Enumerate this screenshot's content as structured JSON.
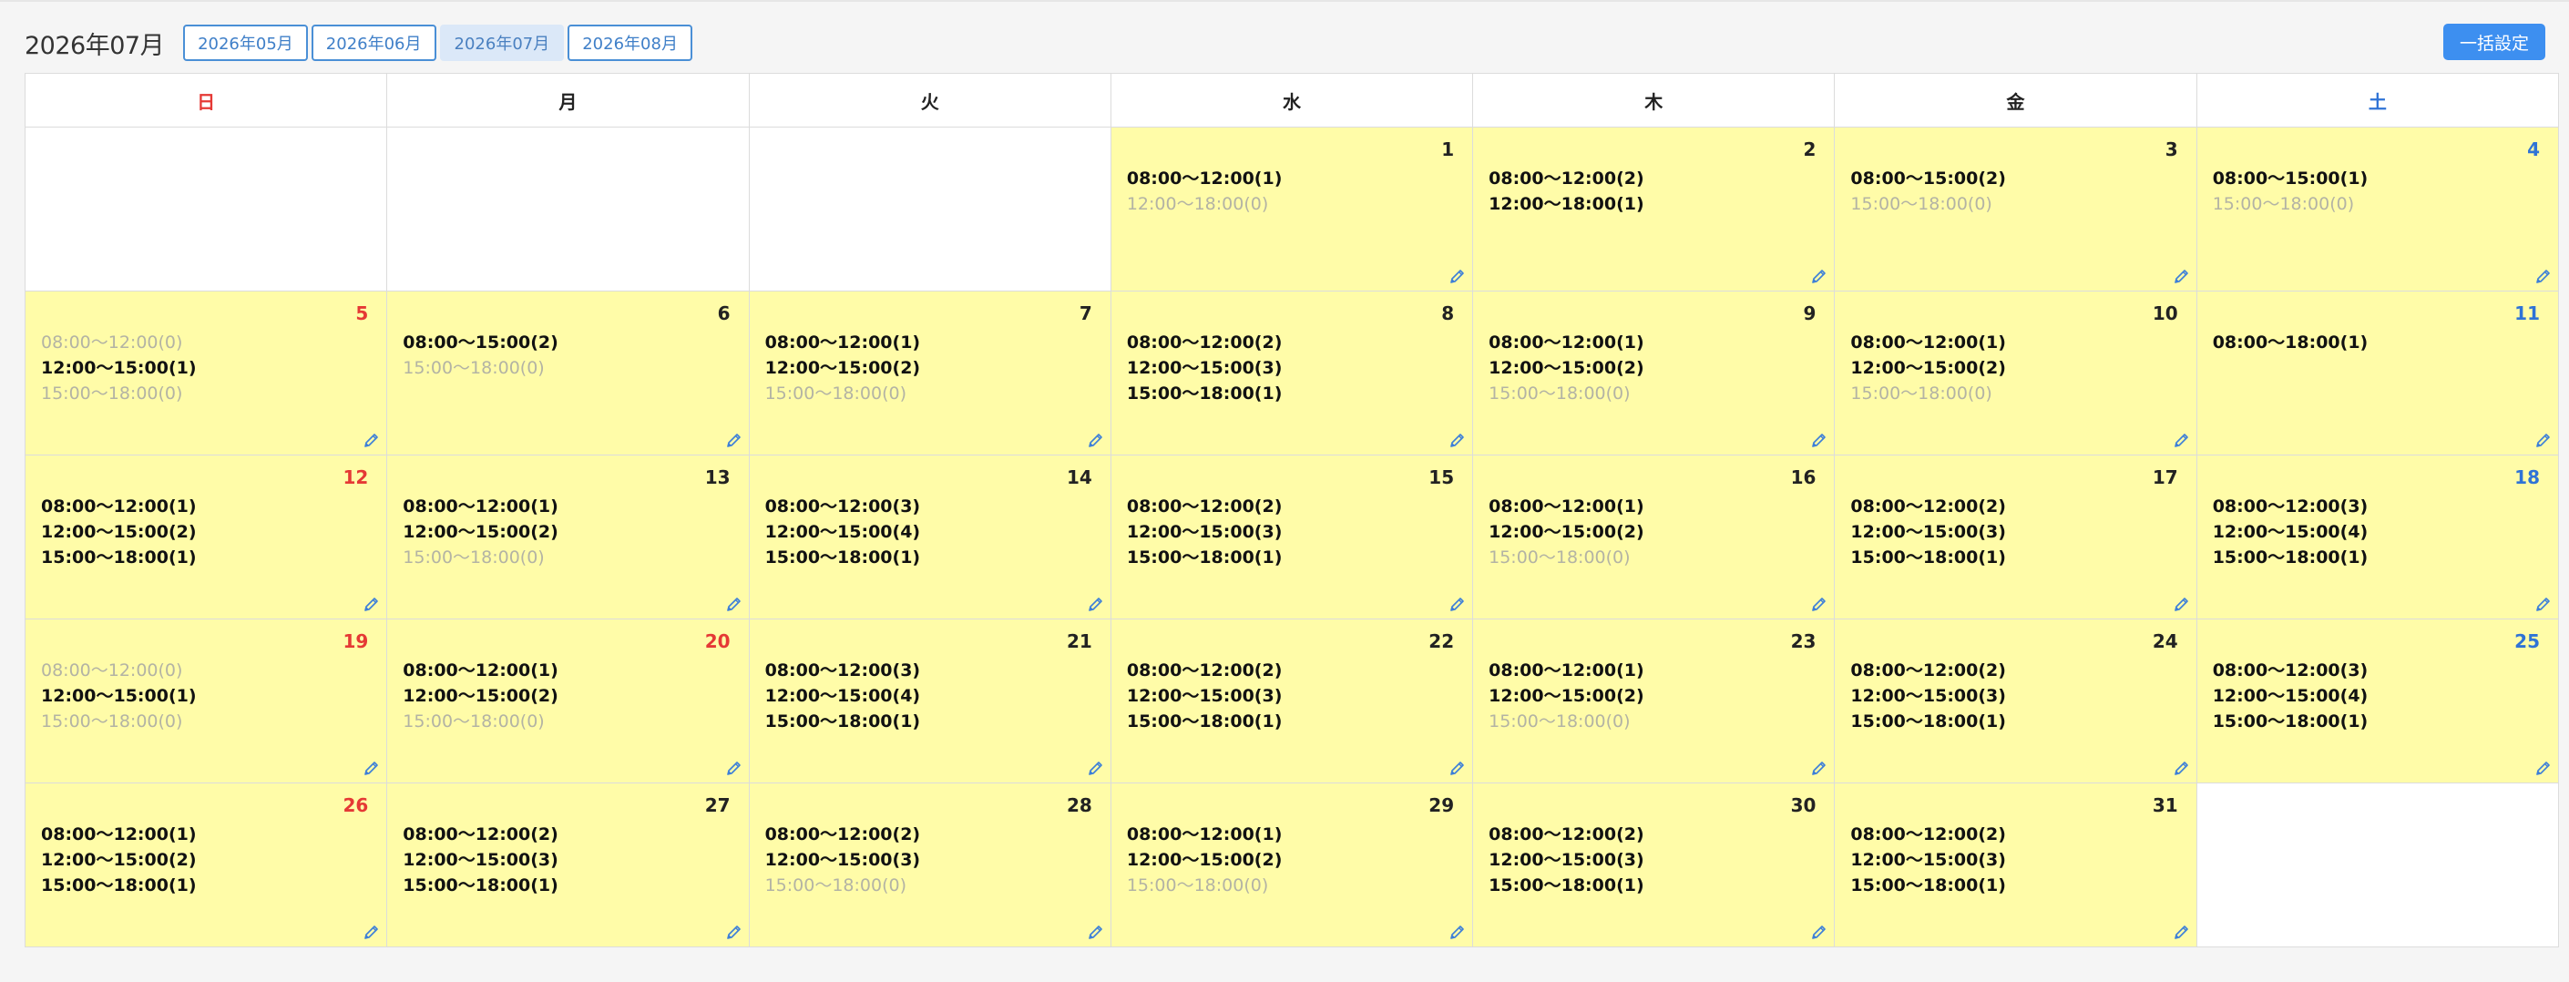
{
  "header": {
    "title": "2026年07月",
    "months": [
      {
        "label": "2026年05月",
        "active": false
      },
      {
        "label": "2026年06月",
        "active": false
      },
      {
        "label": "2026年07月",
        "active": true
      },
      {
        "label": "2026年08月",
        "active": false
      }
    ],
    "bulk_label": "一括設定"
  },
  "weekdays": [
    "日",
    "月",
    "火",
    "水",
    "木",
    "金",
    "土"
  ],
  "colors": {
    "sunday": "#e53935",
    "saturday": "#2f73d6",
    "cell_fill": "#fffca8",
    "accent": "#3d8ff0"
  },
  "weeks": [
    [
      null,
      null,
      null,
      {
        "day": "1",
        "slots": [
          {
            "text": "08:00〜12:00(1)",
            "zero": false
          },
          {
            "text": "12:00〜18:00(0)",
            "zero": true
          }
        ]
      },
      {
        "day": "2",
        "slots": [
          {
            "text": "08:00〜12:00(2)",
            "zero": false
          },
          {
            "text": "12:00〜18:00(1)",
            "zero": false
          }
        ]
      },
      {
        "day": "3",
        "slots": [
          {
            "text": "08:00〜15:00(2)",
            "zero": false
          },
          {
            "text": "15:00〜18:00(0)",
            "zero": true
          }
        ]
      },
      {
        "day": "4",
        "slots": [
          {
            "text": "08:00〜15:00(1)",
            "zero": false
          },
          {
            "text": "15:00〜18:00(0)",
            "zero": true
          }
        ]
      }
    ],
    [
      {
        "day": "5",
        "slots": [
          {
            "text": "08:00〜12:00(0)",
            "zero": true
          },
          {
            "text": "12:00〜15:00(1)",
            "zero": false
          },
          {
            "text": "15:00〜18:00(0)",
            "zero": true
          }
        ]
      },
      {
        "day": "6",
        "slots": [
          {
            "text": "08:00〜15:00(2)",
            "zero": false
          },
          {
            "text": "15:00〜18:00(0)",
            "zero": true
          }
        ]
      },
      {
        "day": "7",
        "slots": [
          {
            "text": "08:00〜12:00(1)",
            "zero": false
          },
          {
            "text": "12:00〜15:00(2)",
            "zero": false
          },
          {
            "text": "15:00〜18:00(0)",
            "zero": true
          }
        ]
      },
      {
        "day": "8",
        "slots": [
          {
            "text": "08:00〜12:00(2)",
            "zero": false
          },
          {
            "text": "12:00〜15:00(3)",
            "zero": false
          },
          {
            "text": "15:00〜18:00(1)",
            "zero": false
          }
        ]
      },
      {
        "day": "9",
        "slots": [
          {
            "text": "08:00〜12:00(1)",
            "zero": false
          },
          {
            "text": "12:00〜15:00(2)",
            "zero": false
          },
          {
            "text": "15:00〜18:00(0)",
            "zero": true
          }
        ]
      },
      {
        "day": "10",
        "slots": [
          {
            "text": "08:00〜12:00(1)",
            "zero": false
          },
          {
            "text": "12:00〜15:00(2)",
            "zero": false
          },
          {
            "text": "15:00〜18:00(0)",
            "zero": true
          }
        ]
      },
      {
        "day": "11",
        "slots": [
          {
            "text": "08:00〜18:00(1)",
            "zero": false
          }
        ]
      }
    ],
    [
      {
        "day": "12",
        "slots": [
          {
            "text": "08:00〜12:00(1)",
            "zero": false
          },
          {
            "text": "12:00〜15:00(2)",
            "zero": false
          },
          {
            "text": "15:00〜18:00(1)",
            "zero": false
          }
        ]
      },
      {
        "day": "13",
        "slots": [
          {
            "text": "08:00〜12:00(1)",
            "zero": false
          },
          {
            "text": "12:00〜15:00(2)",
            "zero": false
          },
          {
            "text": "15:00〜18:00(0)",
            "zero": true
          }
        ]
      },
      {
        "day": "14",
        "slots": [
          {
            "text": "08:00〜12:00(3)",
            "zero": false
          },
          {
            "text": "12:00〜15:00(4)",
            "zero": false
          },
          {
            "text": "15:00〜18:00(1)",
            "zero": false
          }
        ]
      },
      {
        "day": "15",
        "slots": [
          {
            "text": "08:00〜12:00(2)",
            "zero": false
          },
          {
            "text": "12:00〜15:00(3)",
            "zero": false
          },
          {
            "text": "15:00〜18:00(1)",
            "zero": false
          }
        ]
      },
      {
        "day": "16",
        "slots": [
          {
            "text": "08:00〜12:00(1)",
            "zero": false
          },
          {
            "text": "12:00〜15:00(2)",
            "zero": false
          },
          {
            "text": "15:00〜18:00(0)",
            "zero": true
          }
        ]
      },
      {
        "day": "17",
        "slots": [
          {
            "text": "08:00〜12:00(2)",
            "zero": false
          },
          {
            "text": "12:00〜15:00(3)",
            "zero": false
          },
          {
            "text": "15:00〜18:00(1)",
            "zero": false
          }
        ]
      },
      {
        "day": "18",
        "slots": [
          {
            "text": "08:00〜12:00(3)",
            "zero": false
          },
          {
            "text": "12:00〜15:00(4)",
            "zero": false
          },
          {
            "text": "15:00〜18:00(1)",
            "zero": false
          }
        ]
      }
    ],
    [
      {
        "day": "19",
        "slots": [
          {
            "text": "08:00〜12:00(0)",
            "zero": true
          },
          {
            "text": "12:00〜15:00(1)",
            "zero": false
          },
          {
            "text": "15:00〜18:00(0)",
            "zero": true
          }
        ]
      },
      {
        "day": "20",
        "holiday": true,
        "slots": [
          {
            "text": "08:00〜12:00(1)",
            "zero": false
          },
          {
            "text": "12:00〜15:00(2)",
            "zero": false
          },
          {
            "text": "15:00〜18:00(0)",
            "zero": true
          }
        ]
      },
      {
        "day": "21",
        "slots": [
          {
            "text": "08:00〜12:00(3)",
            "zero": false
          },
          {
            "text": "12:00〜15:00(4)",
            "zero": false
          },
          {
            "text": "15:00〜18:00(1)",
            "zero": false
          }
        ]
      },
      {
        "day": "22",
        "slots": [
          {
            "text": "08:00〜12:00(2)",
            "zero": false
          },
          {
            "text": "12:00〜15:00(3)",
            "zero": false
          },
          {
            "text": "15:00〜18:00(1)",
            "zero": false
          }
        ]
      },
      {
        "day": "23",
        "slots": [
          {
            "text": "08:00〜12:00(1)",
            "zero": false
          },
          {
            "text": "12:00〜15:00(2)",
            "zero": false
          },
          {
            "text": "15:00〜18:00(0)",
            "zero": true
          }
        ]
      },
      {
        "day": "24",
        "slots": [
          {
            "text": "08:00〜12:00(2)",
            "zero": false
          },
          {
            "text": "12:00〜15:00(3)",
            "zero": false
          },
          {
            "text": "15:00〜18:00(1)",
            "zero": false
          }
        ]
      },
      {
        "day": "25",
        "slots": [
          {
            "text": "08:00〜12:00(3)",
            "zero": false
          },
          {
            "text": "12:00〜15:00(4)",
            "zero": false
          },
          {
            "text": "15:00〜18:00(1)",
            "zero": false
          }
        ]
      }
    ],
    [
      {
        "day": "26",
        "slots": [
          {
            "text": "08:00〜12:00(1)",
            "zero": false
          },
          {
            "text": "12:00〜15:00(2)",
            "zero": false
          },
          {
            "text": "15:00〜18:00(1)",
            "zero": false
          }
        ]
      },
      {
        "day": "27",
        "slots": [
          {
            "text": "08:00〜12:00(2)",
            "zero": false
          },
          {
            "text": "12:00〜15:00(3)",
            "zero": false
          },
          {
            "text": "15:00〜18:00(1)",
            "zero": false
          }
        ]
      },
      {
        "day": "28",
        "slots": [
          {
            "text": "08:00〜12:00(2)",
            "zero": false
          },
          {
            "text": "12:00〜15:00(3)",
            "zero": false
          },
          {
            "text": "15:00〜18:00(0)",
            "zero": true
          }
        ]
      },
      {
        "day": "29",
        "slots": [
          {
            "text": "08:00〜12:00(1)",
            "zero": false
          },
          {
            "text": "12:00〜15:00(2)",
            "zero": false
          },
          {
            "text": "15:00〜18:00(0)",
            "zero": true
          }
        ]
      },
      {
        "day": "30",
        "slots": [
          {
            "text": "08:00〜12:00(2)",
            "zero": false
          },
          {
            "text": "12:00〜15:00(3)",
            "zero": false
          },
          {
            "text": "15:00〜18:00(1)",
            "zero": false
          }
        ]
      },
      {
        "day": "31",
        "slots": [
          {
            "text": "08:00〜12:00(2)",
            "zero": false
          },
          {
            "text": "12:00〜15:00(3)",
            "zero": false
          },
          {
            "text": "15:00〜18:00(1)",
            "zero": false
          }
        ]
      },
      null
    ]
  ]
}
